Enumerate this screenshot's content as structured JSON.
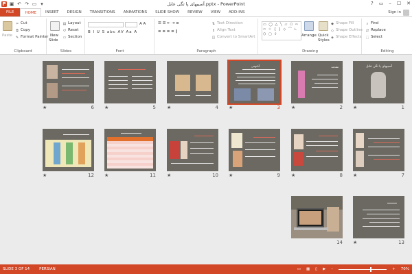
{
  "window": {
    "title": "آسیبهای پا تگی عابل.pptx - PowerPoint",
    "buttons": [
      "?",
      "▭",
      "–",
      "☐",
      "✕"
    ]
  },
  "qat": {
    "logo": "P",
    "save_icon": "save-icon",
    "undo_icon": "undo-icon",
    "redo_icon": "redo-icon"
  },
  "tabs": [
    "FILE",
    "HOME",
    "INSERT",
    "DESIGN",
    "TRANSITIONS",
    "ANIMATIONS",
    "SLIDE SHOW",
    "REVIEW",
    "VIEW",
    "ADD-INS"
  ],
  "active_tab": "HOME",
  "signin": "Sign in",
  "ribbon": {
    "clipboard": {
      "paste": "Paste",
      "cut": "Cut",
      "copy": "Copy",
      "format_painter": "Format Painter",
      "label": "Clipboard"
    },
    "slides": {
      "new_slide": "New",
      "new_slide_2": "Slide",
      "layout": "Layout",
      "reset": "Reset",
      "section": "Section",
      "label": "Slides"
    },
    "font": {
      "label": "Font",
      "row2": "B  I  U  S  abc  AV  Aa  A"
    },
    "paragraph": {
      "text_direction": "Text Direction",
      "align_text": "Align Text",
      "convert": "Convert to SmartArt",
      "label": "Paragraph"
    },
    "drawing": {
      "arrange": "Arrange",
      "quick": "Quick",
      "styles": "Styles",
      "shape_fill": "Shape Fill",
      "shape_outline": "Shape Outline",
      "shape_effects": "Shape Effects",
      "label": "Drawing",
      "shapes": "▭ ◯ △ ╲ ▱ ⬠ ⇨ ⇦ ☆ { } ◇ ⌒ ∟ ⬡ ▢ ⇧"
    },
    "editing": {
      "find": "Find",
      "replace": "Replace",
      "select": "Select",
      "label": "Editing"
    }
  },
  "slides": [
    {
      "number": "1",
      "title": "آسیبهای پا تگی عابل",
      "selected": false
    },
    {
      "number": "2",
      "title": "مقدمه",
      "selected": false
    },
    {
      "number": "3",
      "title": "آناتومی",
      "selected": true
    },
    {
      "number": "4",
      "title": "",
      "selected": false
    },
    {
      "number": "5",
      "title": "",
      "selected": false
    },
    {
      "number": "6",
      "title": "",
      "selected": false
    },
    {
      "number": "7",
      "title": "",
      "selected": false
    },
    {
      "number": "8",
      "title": "",
      "selected": false
    },
    {
      "number": "9",
      "title": "",
      "selected": false
    },
    {
      "number": "10",
      "title": "",
      "selected": false
    },
    {
      "number": "11",
      "title": "",
      "selected": false
    },
    {
      "number": "12",
      "title": "",
      "selected": false
    },
    {
      "number": "13",
      "title": "",
      "selected": false
    },
    {
      "number": "14",
      "title": "",
      "selected": false
    }
  ],
  "status": {
    "slide_info": "SLIDE 3 OF 14",
    "language": "PERSIAN",
    "zoom": "70%"
  },
  "colors": {
    "accent": "#d24726",
    "slide_bg": "#6b6961"
  }
}
